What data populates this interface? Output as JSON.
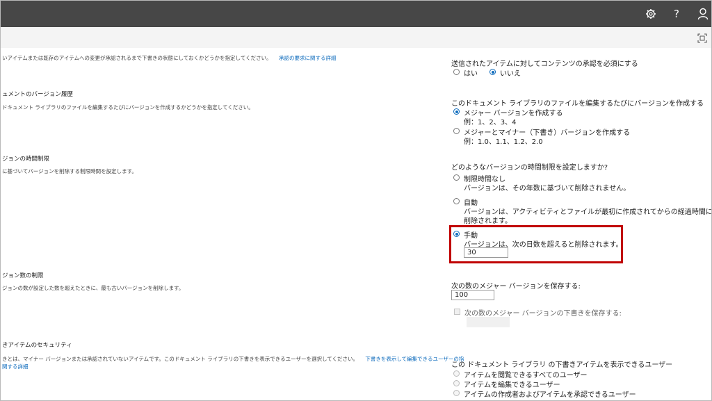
{
  "header": {
    "settings_icon": "gear-icon",
    "help_label": "?",
    "user_icon": "person-icon",
    "focus_icon": "focus-mode-icon"
  },
  "left": {
    "approval_desc": "いアイテムまたは既存のアイテムへの変更が承認されるまで下書きの状態にしておくかどうかを指定してください。",
    "approval_link": "承認の要求に関する詳細",
    "history_heading": "ュメントのバージョン履歴",
    "history_desc": "ドキュメント ライブラリのファイルを編集するたびにバージョンを作成するかどうかを指定してください。",
    "timelimit_heading": "ジョンの時間制限",
    "timelimit_desc": "に基づいてバージョンを削除する制限時間を設定します。",
    "count_heading": "ジョン数の制限",
    "count_desc": "ジョンの数が設定した数を超えたときに、最も古いバージョンを削除します。",
    "security_heading": "きアイテムのセキュリティ",
    "security_desc": "きとは、マイナー バージョンまたは承認されていないアイテムです。このドキュメント ライブラリの下書きを表示できるユーザーを選択してください。",
    "security_link1": "下書きを表示して編集できるユーザーの指",
    "security_link2": "関する詳細"
  },
  "right": {
    "approval_question": "送信されたアイテムに対してコンテンツの承認を必須にする",
    "yes_label": "はい",
    "no_label": "いいえ",
    "versioning_question": "このドキュメント ライブラリのファイルを編集するたびにバージョンを作成する",
    "major_label": "メジャー バージョンを作成する",
    "major_example": "例：1、2、3、4",
    "minor_label": "メジャーとマイナー（下書き）バージョンを作成する",
    "minor_example": "例：1.0、1.1、1.2、2.0",
    "timelimit_question": "どのようなバージョンの時間制限を設定しますか?",
    "nolimit_label": "制限時間なし",
    "nolimit_desc": "バージョンは、その年数に基づいて削除されません。",
    "auto_label": "自動",
    "auto_desc1": "バージョンは、アクティビティとファイルが最初に作成されてからの経過時間に基づいて",
    "auto_desc2": "削除されます。",
    "manual_label": "手動",
    "manual_desc": "バージョンは、次の日数を超えると削除されます。",
    "manual_days": "30",
    "major_keep_label": "次の数のメジャー バージョンを保存する:",
    "major_keep_value": "100",
    "draft_keep_label": "次の数のメジャー バージョンの下書きを保存する:",
    "draft_visibility_question": "この ドキュメント ライブラリ の下書きアイテムを表示できるユーザー",
    "readers_label": "アイテムを閲覧できるすべてのユーザー",
    "editors_label": "アイテムを編集できるユーザー",
    "approvers_label": "アイテムの作成者およびアイテムを承認できるユーザー"
  }
}
